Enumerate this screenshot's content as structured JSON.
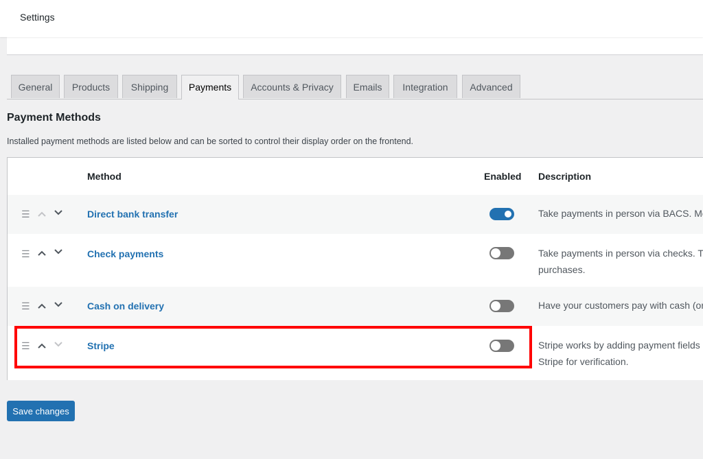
{
  "header": {
    "title": "Settings"
  },
  "tabs": [
    {
      "label": "General"
    },
    {
      "label": "Products"
    },
    {
      "label": "Shipping"
    },
    {
      "label": "Payments",
      "active": true
    },
    {
      "label": "Accounts & Privacy"
    },
    {
      "label": "Emails"
    },
    {
      "label": "Integration"
    },
    {
      "label": "Advanced"
    }
  ],
  "section": {
    "title": "Payment Methods",
    "description": "Installed payment methods are listed below and can be sorted to control their display order on the frontend."
  },
  "table": {
    "columns": {
      "method": "Method",
      "enabled": "Enabled",
      "description": "Description"
    },
    "rows": [
      {
        "name": "Direct bank transfer",
        "enabled": true,
        "description_line1": "Take payments in person via BACS. Mor",
        "description_line2": ""
      },
      {
        "name": "Check payments",
        "enabled": false,
        "description_line1": "Take payments in person via checks. Th",
        "description_line2": "purchases."
      },
      {
        "name": "Cash on delivery",
        "enabled": false,
        "description_line1": "Have your customers pay with cash (or",
        "description_line2": ""
      },
      {
        "name": "Stripe",
        "enabled": false,
        "description_line1": "Stripe works by adding payment fields o",
        "description_line2": "Stripe for verification."
      }
    ]
  },
  "actions": {
    "save_label": "Save changes"
  },
  "colors": {
    "accent": "#2271b1",
    "highlight": "#ff0000",
    "background": "#f0f0f1"
  },
  "icons": {
    "drag": "drag-handle-icon",
    "up": "chevron-up-icon",
    "down": "chevron-down-icon"
  }
}
